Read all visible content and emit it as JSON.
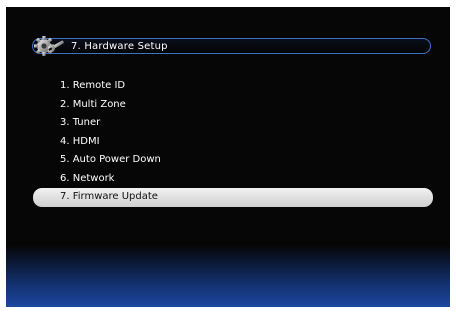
{
  "header": {
    "title": "7. Hardware Setup",
    "icon": "gear-wrench-icon",
    "accent_color": "#3e71c6"
  },
  "menu": {
    "items": [
      {
        "label": "1. Remote ID",
        "selected": false
      },
      {
        "label": "2. Multi Zone",
        "selected": false
      },
      {
        "label": "3. Tuner",
        "selected": false
      },
      {
        "label": "4. HDMI",
        "selected": false
      },
      {
        "label": "5. Auto Power Down",
        "selected": false
      },
      {
        "label": "6. Network",
        "selected": false
      },
      {
        "label": "7. Firmware Update",
        "selected": true
      }
    ],
    "selected_color": "#e6e6e6"
  },
  "colors": {
    "background": "#060606",
    "bottom_gradient": "#1c46a0"
  }
}
